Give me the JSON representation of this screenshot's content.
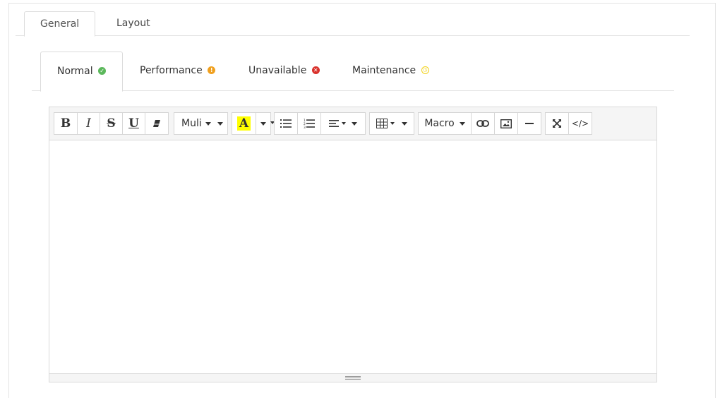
{
  "tabs": [
    "General",
    "Layout"
  ],
  "status_tabs": [
    {
      "label": "Normal",
      "icon": "check-circle-icon"
    },
    {
      "label": "Performance",
      "icon": "exclamation-circle-icon"
    },
    {
      "label": "Unavailable",
      "icon": "times-circle-icon"
    },
    {
      "label": "Maintenance",
      "icon": "clock-circle-icon"
    }
  ],
  "toolbar": {
    "bold": "B",
    "italic": "I",
    "strike": "S",
    "underline": "U",
    "font_name": "Muli",
    "highlight": "A",
    "macro": "Macro",
    "code": "</>"
  },
  "colors": {
    "ok": "#5cb85c",
    "warn": "#f0a01f",
    "err": "#d9312b",
    "maintenance": "#f2d21a",
    "highlight": "#ffff00"
  }
}
